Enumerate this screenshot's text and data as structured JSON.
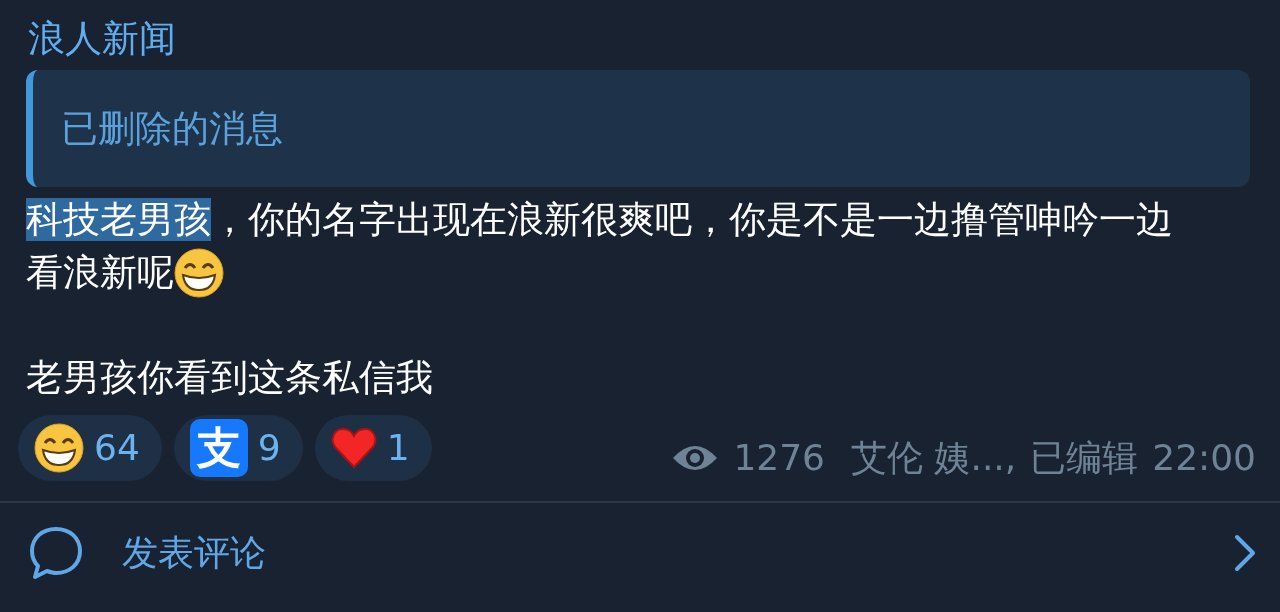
{
  "channel_name": "浪人新闻",
  "reply": {
    "text": "已删除的消息"
  },
  "message": {
    "lines": [
      {
        "segments": [
          {
            "text": "科技老男孩",
            "selected": true
          },
          {
            "text": "，你的名字出现在浪新很爽吧，你是不是一边撸管呻吟一边",
            "selected": false
          }
        ]
      },
      {
        "segments": [
          {
            "text": "看浪新呢",
            "selected": false
          }
        ]
      }
    ],
    "second_paragraph": "老男孩你看到这条私信我"
  },
  "reactions": [
    {
      "kind": "grin",
      "count": "64"
    },
    {
      "kind": "logo",
      "logo_text": "支",
      "count": "9"
    },
    {
      "kind": "heart",
      "count": "1"
    }
  ],
  "meta": {
    "views": "1276",
    "signature": "艾伦 姨...,",
    "edited": "已编辑",
    "time": "22:00"
  },
  "comments": {
    "label": "发表评论"
  }
}
